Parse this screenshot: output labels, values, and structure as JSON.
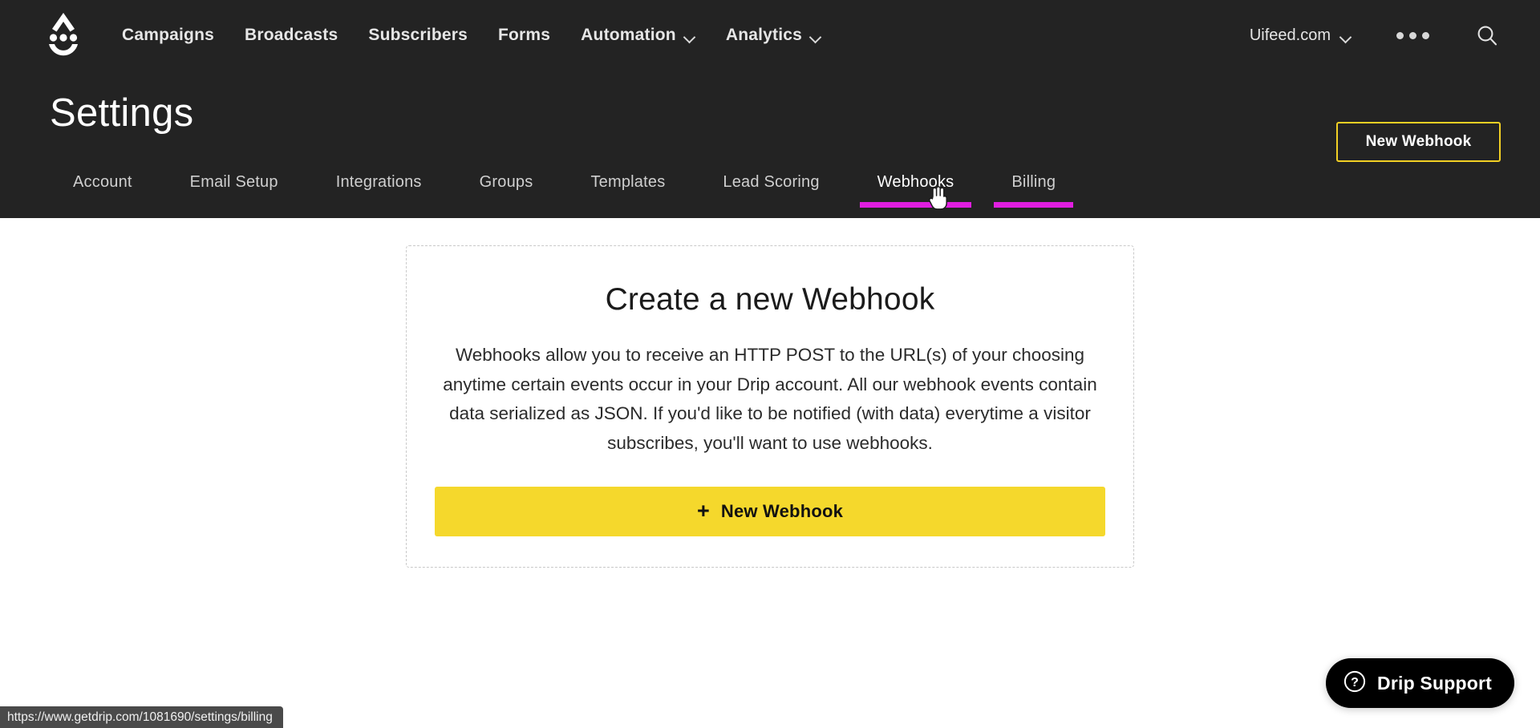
{
  "app": {
    "brand_icon": "drip-logo-icon",
    "accent_yellow": "#f5d82c",
    "accent_magenta": "#e01ee0",
    "dark_bg": "#232323"
  },
  "topnav": {
    "links": [
      {
        "label": "Campaigns",
        "has_chevron": false
      },
      {
        "label": "Broadcasts",
        "has_chevron": false
      },
      {
        "label": "Subscribers",
        "has_chevron": false
      },
      {
        "label": "Forms",
        "has_chevron": false
      },
      {
        "label": "Automation",
        "has_chevron": true
      },
      {
        "label": "Analytics",
        "has_chevron": true
      }
    ],
    "account": {
      "label": "Uifeed.com",
      "chevron_icon": "chevron-down-icon"
    },
    "more_icon": "more-dots-icon",
    "search_icon": "search-icon"
  },
  "header": {
    "title": "Settings",
    "action_label": "New Webhook"
  },
  "subtabs": {
    "items": [
      {
        "label": "Account",
        "state": "default"
      },
      {
        "label": "Email Setup",
        "state": "default"
      },
      {
        "label": "Integrations",
        "state": "default"
      },
      {
        "label": "Groups",
        "state": "default"
      },
      {
        "label": "Templates",
        "state": "default"
      },
      {
        "label": "Lead Scoring",
        "state": "default"
      },
      {
        "label": "Webhooks",
        "state": "active"
      },
      {
        "label": "Billing",
        "state": "hovered"
      }
    ]
  },
  "card": {
    "title": "Create a new Webhook",
    "description": "Webhooks allow you to receive an HTTP POST to the URL(s) of your choosing anytime certain events occur in your Drip account. All our webhook events contain data serialized as JSON. If you'd like to be notified (with data) everytime a visitor subscribes, you'll want to use webhooks.",
    "button_plus": "+",
    "button_label": "New Webhook"
  },
  "support": {
    "icon": "question-circle-icon",
    "label": "Drip Support"
  },
  "status_bar": {
    "url": "https://www.getdrip.com/1081690/settings/billing"
  }
}
